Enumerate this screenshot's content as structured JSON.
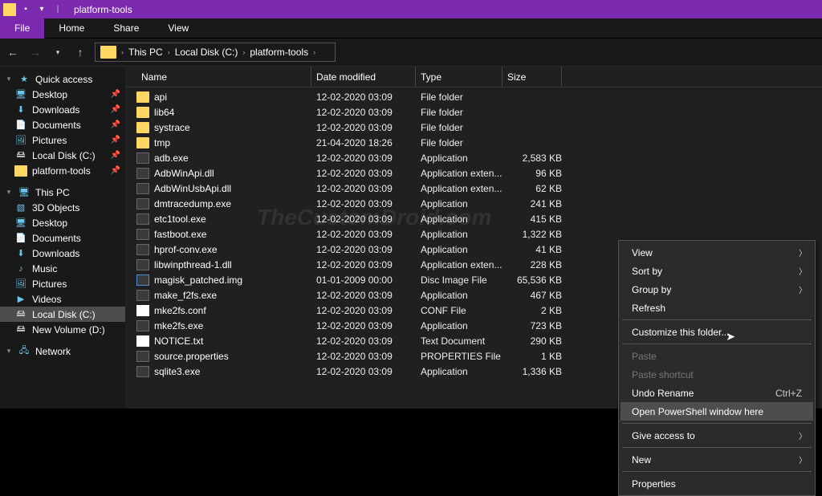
{
  "window": {
    "title": "platform-tools"
  },
  "ribbon": {
    "file": "File",
    "home": "Home",
    "share": "Share",
    "view": "View"
  },
  "breadcrumbs": [
    "This PC",
    "Local Disk (C:)",
    "platform-tools"
  ],
  "columns": {
    "name": "Name",
    "date": "Date modified",
    "type": "Type",
    "size": "Size"
  },
  "sidebar": {
    "quick": {
      "label": "Quick access",
      "items": [
        {
          "label": "Desktop",
          "icon": "monitor",
          "pinned": true
        },
        {
          "label": "Downloads",
          "icon": "dl",
          "pinned": true
        },
        {
          "label": "Documents",
          "icon": "doc",
          "pinned": true
        },
        {
          "label": "Pictures",
          "icon": "pic",
          "pinned": true
        },
        {
          "label": "Local Disk (C:)",
          "icon": "disk",
          "pinned": true
        },
        {
          "label": "platform-tools",
          "icon": "folder",
          "pinned": true
        }
      ]
    },
    "thispc": {
      "label": "This PC",
      "items": [
        {
          "label": "3D Objects",
          "icon": "cube"
        },
        {
          "label": "Desktop",
          "icon": "monitor"
        },
        {
          "label": "Documents",
          "icon": "doc"
        },
        {
          "label": "Downloads",
          "icon": "dl"
        },
        {
          "label": "Music",
          "icon": "music"
        },
        {
          "label": "Pictures",
          "icon": "pic"
        },
        {
          "label": "Videos",
          "icon": "video"
        },
        {
          "label": "Local Disk (C:)",
          "icon": "disk",
          "selected": true
        },
        {
          "label": "New Volume (D:)",
          "icon": "disk"
        }
      ]
    },
    "network": {
      "label": "Network"
    }
  },
  "files": [
    {
      "name": "api",
      "date": "12-02-2020 03:09",
      "type": "File folder",
      "size": "",
      "icon": "folder"
    },
    {
      "name": "lib64",
      "date": "12-02-2020 03:09",
      "type": "File folder",
      "size": "",
      "icon": "folder"
    },
    {
      "name": "systrace",
      "date": "12-02-2020 03:09",
      "type": "File folder",
      "size": "",
      "icon": "folder"
    },
    {
      "name": "tmp",
      "date": "21-04-2020 18:26",
      "type": "File folder",
      "size": "",
      "icon": "folder"
    },
    {
      "name": "adb.exe",
      "date": "12-02-2020 03:09",
      "type": "Application",
      "size": "2,583 KB",
      "icon": "exe"
    },
    {
      "name": "AdbWinApi.dll",
      "date": "12-02-2020 03:09",
      "type": "Application exten...",
      "size": "96 KB",
      "icon": "dll"
    },
    {
      "name": "AdbWinUsbApi.dll",
      "date": "12-02-2020 03:09",
      "type": "Application exten...",
      "size": "62 KB",
      "icon": "dll"
    },
    {
      "name": "dmtracedump.exe",
      "date": "12-02-2020 03:09",
      "type": "Application",
      "size": "241 KB",
      "icon": "exe"
    },
    {
      "name": "etc1tool.exe",
      "date": "12-02-2020 03:09",
      "type": "Application",
      "size": "415 KB",
      "icon": "exe"
    },
    {
      "name": "fastboot.exe",
      "date": "12-02-2020 03:09",
      "type": "Application",
      "size": "1,322 KB",
      "icon": "exe"
    },
    {
      "name": "hprof-conv.exe",
      "date": "12-02-2020 03:09",
      "type": "Application",
      "size": "41 KB",
      "icon": "exe"
    },
    {
      "name": "libwinpthread-1.dll",
      "date": "12-02-2020 03:09",
      "type": "Application exten...",
      "size": "228 KB",
      "icon": "dll"
    },
    {
      "name": "magisk_patched.img",
      "date": "01-01-2009 00:00",
      "type": "Disc Image File",
      "size": "65,536 KB",
      "icon": "img"
    },
    {
      "name": "make_f2fs.exe",
      "date": "12-02-2020 03:09",
      "type": "Application",
      "size": "467 KB",
      "icon": "exe"
    },
    {
      "name": "mke2fs.conf",
      "date": "12-02-2020 03:09",
      "type": "CONF File",
      "size": "2 KB",
      "icon": "conf"
    },
    {
      "name": "mke2fs.exe",
      "date": "12-02-2020 03:09",
      "type": "Application",
      "size": "723 KB",
      "icon": "exe"
    },
    {
      "name": "NOTICE.txt",
      "date": "12-02-2020 03:09",
      "type": "Text Document",
      "size": "290 KB",
      "icon": "txt"
    },
    {
      "name": "source.properties",
      "date": "12-02-2020 03:09",
      "type": "PROPERTIES File",
      "size": "1 KB",
      "icon": "prop"
    },
    {
      "name": "sqlite3.exe",
      "date": "12-02-2020 03:09",
      "type": "Application",
      "size": "1,336 KB",
      "icon": "exe"
    }
  ],
  "context_menu": [
    {
      "label": "View",
      "submenu": true
    },
    {
      "label": "Sort by",
      "submenu": true
    },
    {
      "label": "Group by",
      "submenu": true
    },
    {
      "label": "Refresh"
    },
    {
      "divider": true
    },
    {
      "label": "Customize this folder..."
    },
    {
      "divider": true
    },
    {
      "label": "Paste",
      "disabled": true
    },
    {
      "label": "Paste shortcut",
      "disabled": true
    },
    {
      "label": "Undo Rename",
      "shortcut": "Ctrl+Z"
    },
    {
      "label": "Open PowerShell window here",
      "highlight": true
    },
    {
      "divider": true
    },
    {
      "label": "Give access to",
      "submenu": true
    },
    {
      "divider": true
    },
    {
      "label": "New",
      "submenu": true
    },
    {
      "divider": true
    },
    {
      "label": "Properties"
    }
  ],
  "watermark": "TheCustomDroid.com"
}
